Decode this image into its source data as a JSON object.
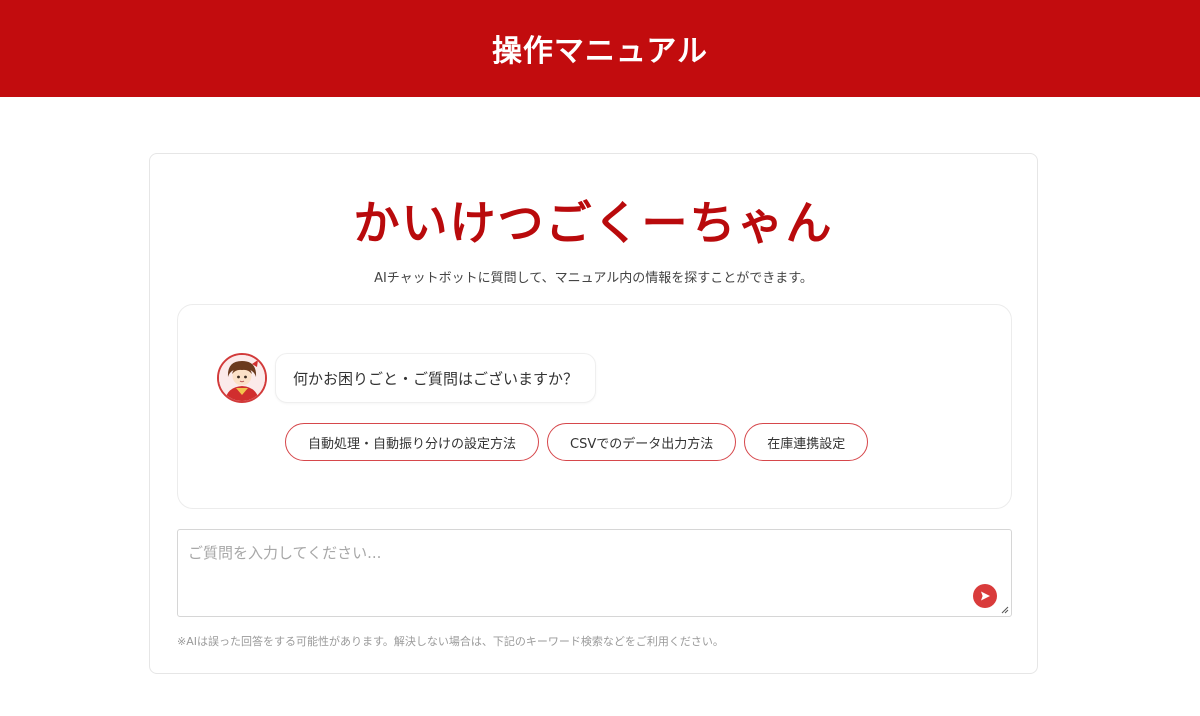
{
  "header": {
    "title": "操作マニュアル"
  },
  "bot": {
    "name": "かいけつごくーちゃん",
    "subtitle": "AIチャットボットに質問して、マニュアル内の情報を探すことができます。"
  },
  "chat": {
    "greeting": "何かお困りごと・ご質問はございますか？",
    "suggestions": [
      {
        "label": "自動処理・自動振り分けの設定方法"
      },
      {
        "label": "CSVでのデータ出力方法"
      },
      {
        "label": "在庫連携設定"
      }
    ]
  },
  "input": {
    "placeholder": "ご質問を入力してください...",
    "value": ""
  },
  "disclaimer": "※AIは誤った回答をする可能性があります。解決しない場合は、下記のキーワード検索などをご利用ください。",
  "colors": {
    "brand": "#c20c0e",
    "title": "#b90a0c",
    "chip_border": "#d6474b",
    "send": "#d93b3b"
  }
}
